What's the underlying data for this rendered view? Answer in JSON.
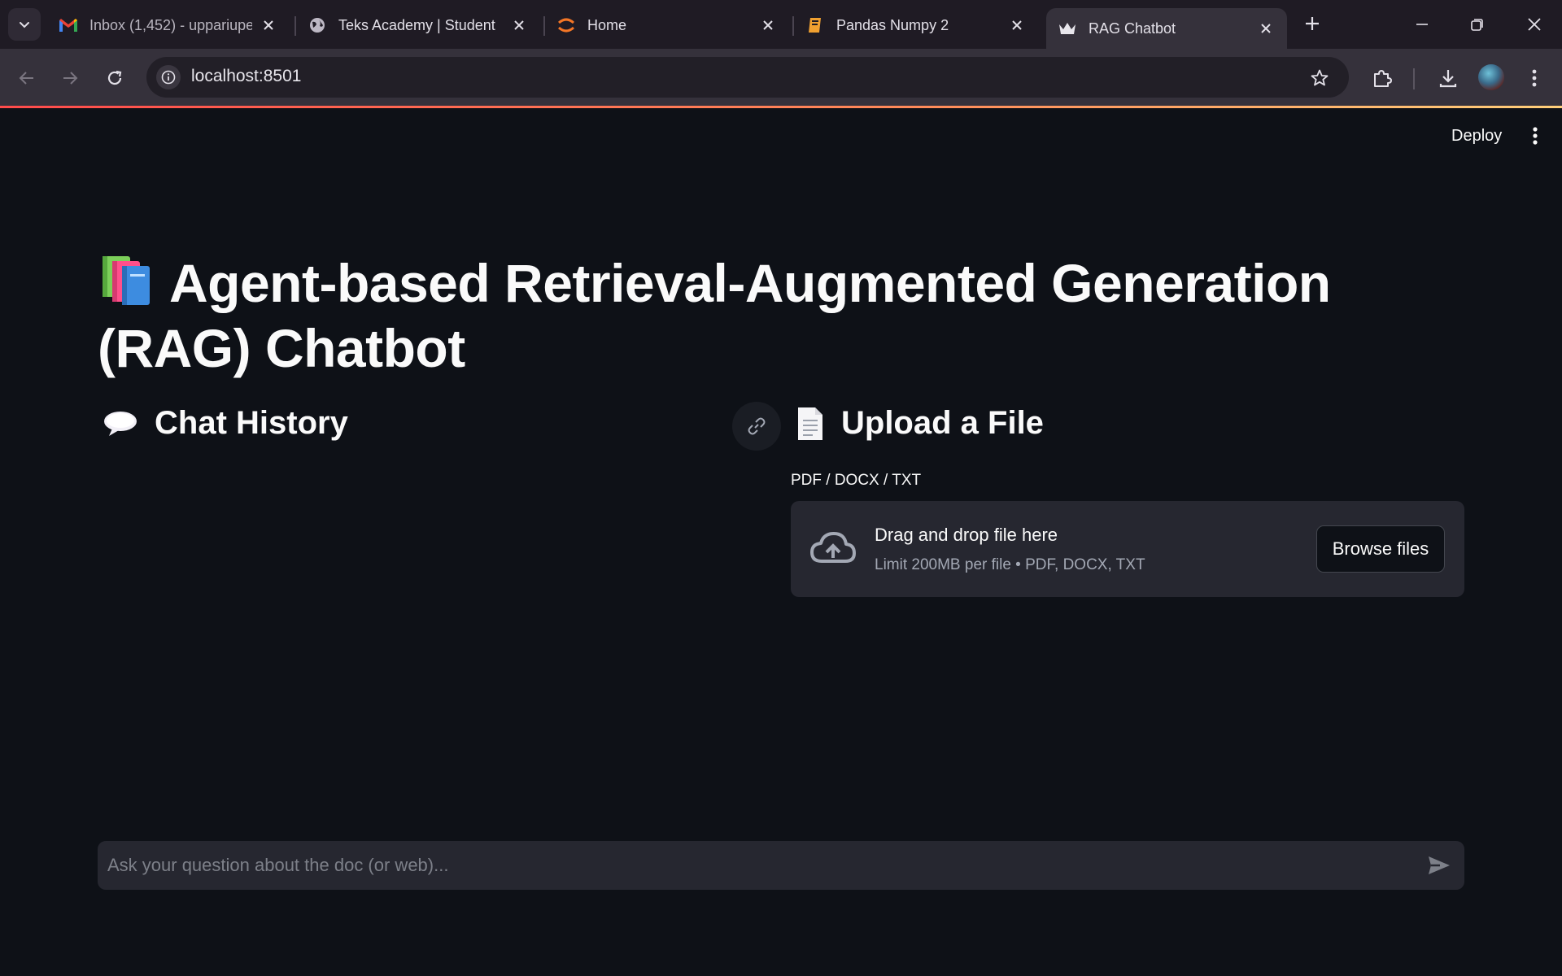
{
  "browser": {
    "tabs": [
      {
        "title": "Inbox (1,452) - uppariupe",
        "icon": "gmail-icon"
      },
      {
        "title": "Teks Academy | Student",
        "icon": "globe-icon"
      },
      {
        "title": "Home",
        "icon": "jupyter-icon"
      },
      {
        "title": "Pandas Numpy 2",
        "icon": "book-icon"
      },
      {
        "title": "RAG Chatbot",
        "icon": "streamlit-crown-icon",
        "active": true
      }
    ],
    "url": "localhost:8501"
  },
  "app": {
    "deploy_label": "Deploy",
    "title_emoji": "books",
    "title": "Agent-based Retrieval-Augmented Generation (RAG) Chatbot",
    "chat_history_heading": "Chat History",
    "upload_heading": "Upload a File",
    "uploader": {
      "label": "PDF / DOCX / TXT",
      "drop_title": "Drag and drop file here",
      "limit_text": "Limit 200MB per file • PDF, DOCX, TXT",
      "browse_label": "Browse files"
    },
    "chat_input": {
      "placeholder": "Ask your question about the doc (or web)..."
    }
  },
  "colors": {
    "background": "#0e1117",
    "surface": "#262730",
    "accent": "#ff4b4b",
    "chrome": "#35313b"
  }
}
